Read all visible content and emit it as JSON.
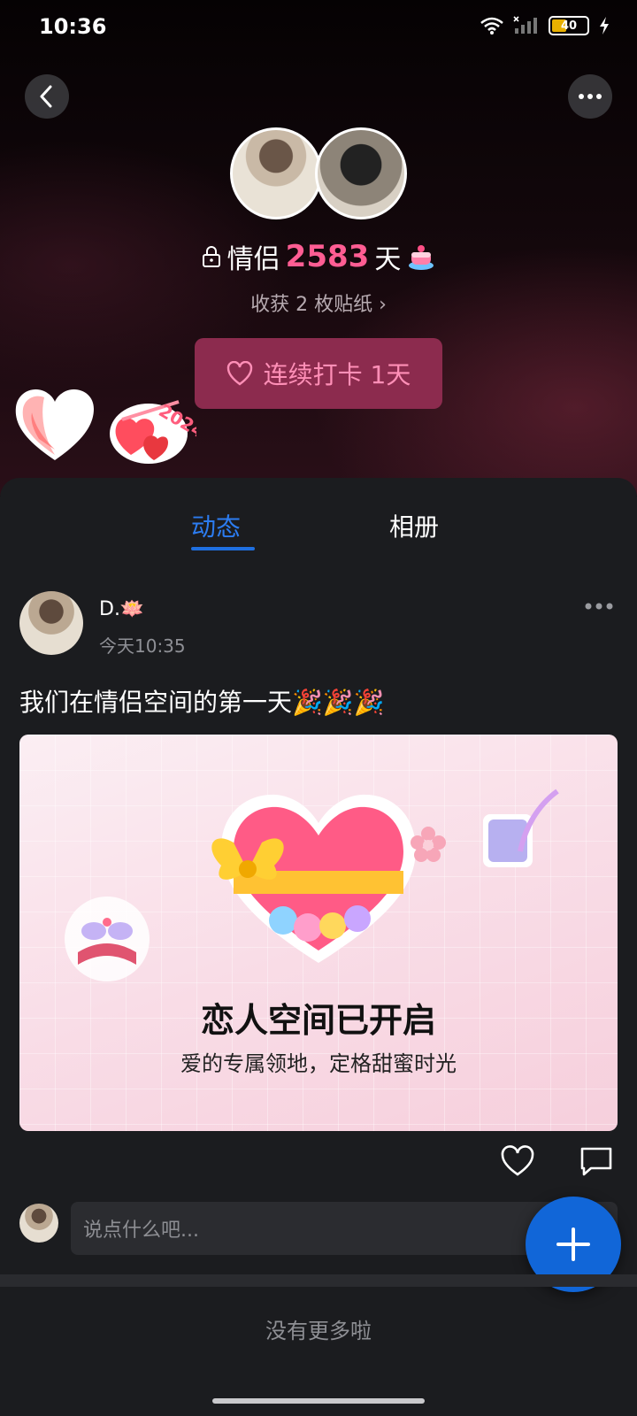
{
  "status_bar": {
    "time": "10:36",
    "battery": "40"
  },
  "header": {
    "lock_icon": "lock-icon",
    "couple_label": "情侣",
    "days": "2583",
    "days_unit": "天",
    "stickers_text": "收获 2 枚贴纸 ›",
    "checkin_label": "连续打卡 1天"
  },
  "tabs": [
    {
      "label": "动态"
    },
    {
      "label": "相册"
    }
  ],
  "active_tab": "动态",
  "post": {
    "author": "D.🪷",
    "time": "今天10:35",
    "text": "我们在情侣空间的第一天🎉🎉🎉",
    "card_title": "恋人空间已开启",
    "card_subtitle": "爱的专属领地，定格甜蜜时光"
  },
  "comment": {
    "placeholder": "说点什么吧..."
  },
  "footer": {
    "no_more": "没有更多啦"
  },
  "colors": {
    "accent_pink": "#ff5d93",
    "tab_blue": "#1f6fe0",
    "fab_blue": "#1166d8",
    "checkin_bg": "#8c2b4e"
  }
}
